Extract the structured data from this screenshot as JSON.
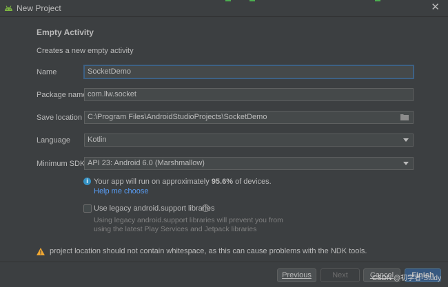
{
  "window": {
    "title": "New Project",
    "close_glyph": "✕"
  },
  "page": {
    "heading": "Empty Activity",
    "subtitle": "Creates a new empty activity"
  },
  "form": {
    "name_label": "Name",
    "name_value": "SocketDemo",
    "package_label": "Package name",
    "package_value": "com.llw.socket",
    "save_label": "Save location",
    "save_value": "C:\\Program Files\\AndroidStudioProjects\\SocketDemo",
    "language_label": "Language",
    "language_value": "Kotlin",
    "minsdk_label": "Minimum SDK",
    "minsdk_value": "API 23: Android 6.0 (Marshmallow)"
  },
  "info": {
    "text_prefix": "Your app will run on approximately ",
    "percent": "95.6%",
    "text_suffix": " of devices.",
    "help_link": "Help me choose"
  },
  "legacy": {
    "checked": false,
    "label": "Use legacy android.support libraries",
    "hint": "Using legacy android.support libraries will prevent you from using the latest Play Services and Jetpack libraries"
  },
  "warning": {
    "text": "project location should not contain whitespace, as this can cause problems with the NDK tools."
  },
  "buttons": {
    "previous": "Previous",
    "next": "Next",
    "cancel": "Cancel",
    "finish": "Finish"
  },
  "watermark": "CSDN @初学者-Study",
  "colors": {
    "background": "#3c3f41",
    "link": "#589df6",
    "primary_button": "#365880",
    "warning": "#f0a732",
    "info": "#3592c4"
  }
}
